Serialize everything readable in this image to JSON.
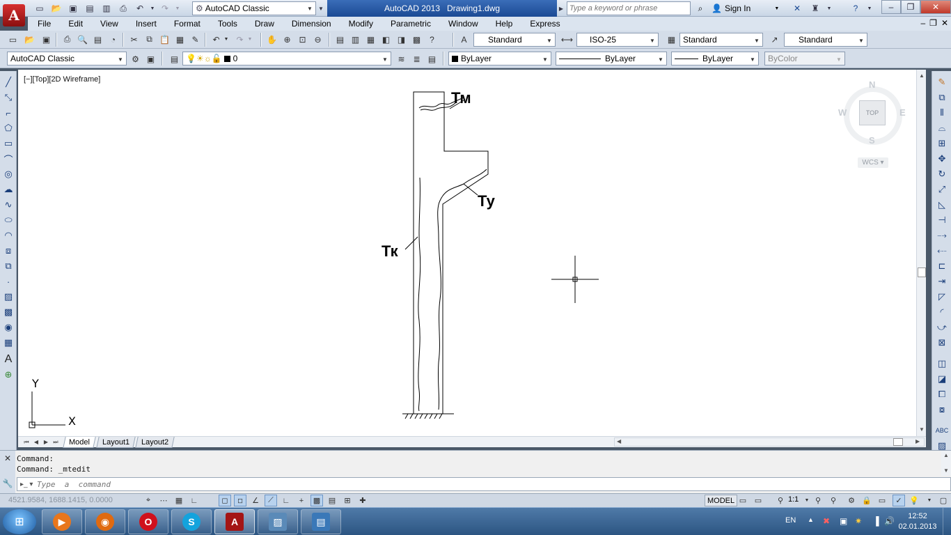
{
  "titlebar": {
    "app_letter": "A",
    "workspace": "AutoCAD Classic",
    "app_name": "AutoCAD 2013",
    "file_name": "Drawing1.dwg",
    "search_placeholder": "Type a keyword or phrase",
    "signin": "Sign In"
  },
  "menu": [
    "File",
    "Edit",
    "View",
    "Insert",
    "Format",
    "Tools",
    "Draw",
    "Dimension",
    "Modify",
    "Parametric",
    "Window",
    "Help",
    "Express"
  ],
  "styles": {
    "text_style": "Standard",
    "dim_style": "ISO-25",
    "table_style": "Standard",
    "mleader_style": "Standard"
  },
  "workspace_toolbar": "AutoCAD Classic",
  "layer": {
    "name": "0"
  },
  "properties": {
    "color": "ByLayer",
    "linetype": "ByLayer",
    "lineweight": "ByLayer",
    "plotstyle": "ByColor"
  },
  "viewport": {
    "label": "[−][Top][2D Wireframe]"
  },
  "drawing": {
    "label_tm": "Тм",
    "label_tu": "Ту",
    "label_tk": "Тк"
  },
  "ucs": {
    "x": "X",
    "y": "Y"
  },
  "viewcube": {
    "n": "N",
    "s": "S",
    "e": "E",
    "w": "W",
    "face": "TOP",
    "wcs": "WCS"
  },
  "layout_tabs": [
    "Model",
    "Layout1",
    "Layout2"
  ],
  "command": {
    "history": [
      "Command:",
      "Command:  _mtedit"
    ],
    "placeholder": "Type  a  command"
  },
  "status": {
    "coords": "4521.9584, 1688.1415, 0.0000",
    "model": "MODEL",
    "anno_scale": "1:1"
  },
  "taskbar": {
    "lang": "EN",
    "time": "12:52",
    "date": "02.01.2013"
  },
  "colors": {
    "accent": "#1b4a94",
    "app_red": "#c0392b",
    "ribbon_bg": "#d4dde9"
  }
}
